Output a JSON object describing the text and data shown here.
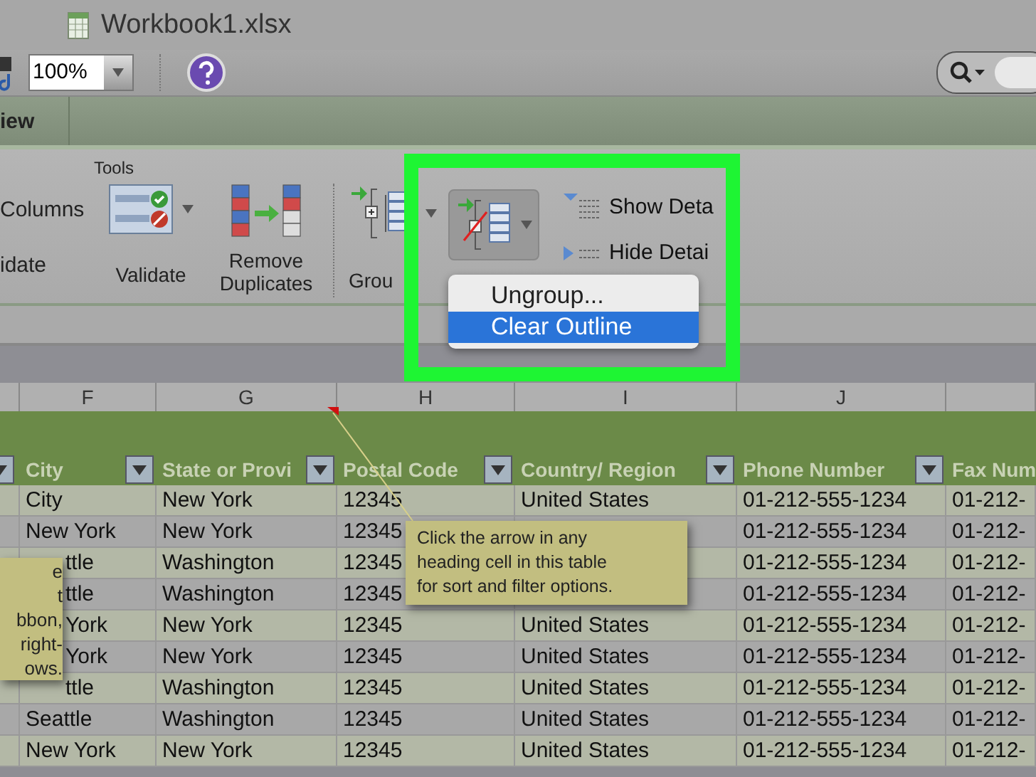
{
  "window": {
    "title": "Workbook1.xlsx"
  },
  "toolbar": {
    "zoom": "100%"
  },
  "tab_bar": {
    "tab": "iew"
  },
  "ribbon": {
    "group_label": "Tools",
    "items": [
      {
        "kind": "text_pair",
        "top": "Columns",
        "bottom": "idate"
      },
      {
        "kind": "validate",
        "label": "Validate"
      },
      {
        "kind": "remove_duplicates",
        "label": "Remove\nDuplicates"
      },
      {
        "kind": "group",
        "label": "Grou"
      },
      {
        "kind": "clear_outline"
      },
      {
        "kind": "detail",
        "top": "Show Deta",
        "bottom": "Hide Detai"
      }
    ]
  },
  "menu": {
    "items": [
      {
        "label": "Ungroup...",
        "selected": false
      },
      {
        "label": "Clear Outline",
        "selected": true
      }
    ]
  },
  "sheet": {
    "column_letters": [
      "F",
      "G",
      "H",
      "I",
      "J"
    ],
    "headers": [
      "City",
      "State or Provi",
      "Postal Code",
      "Country/ Region",
      "Phone Number",
      "Fax Num"
    ],
    "rows": [
      {
        "city_cut": false,
        "cells": [
          "City",
          "New York",
          "12345",
          "United States",
          "01-212-555-1234",
          "01-212-"
        ]
      },
      {
        "city_cut": false,
        "cells": [
          "New York",
          "New York",
          "12345",
          null,
          "01-212-555-1234",
          "01-212-"
        ]
      },
      {
        "city_cut": true,
        "cells": [
          "ttle",
          "Washington",
          "12345",
          null,
          "01-212-555-1234",
          "01-212-"
        ]
      },
      {
        "city_cut": true,
        "cells": [
          "ttle",
          "Washington",
          "12345",
          null,
          "01-212-555-1234",
          "01-212-"
        ]
      },
      {
        "city_cut": true,
        "cells": [
          "York",
          "New York",
          "12345",
          "United States",
          "01-212-555-1234",
          "01-212-"
        ]
      },
      {
        "city_cut": true,
        "cells": [
          "York",
          "New York",
          "12345",
          "United States",
          "01-212-555-1234",
          "01-212-"
        ]
      },
      {
        "city_cut": true,
        "cells": [
          "ttle",
          "Washington",
          "12345",
          "United States",
          "01-212-555-1234",
          "01-212-"
        ]
      },
      {
        "city_cut": false,
        "cells": [
          "Seattle",
          "Washington",
          "12345",
          "United States",
          "01-212-555-1234",
          "01-212-"
        ]
      },
      {
        "city_cut": false,
        "cells": [
          "New York",
          "New York",
          "12345",
          "United States",
          "01-212-555-1234",
          "01-212-"
        ]
      }
    ]
  },
  "comment": {
    "lines": [
      "Click the arrow in any",
      "heading cell in this table",
      "for sort and filter options."
    ]
  },
  "left_tip": {
    "lines": [
      "e",
      "t",
      "bbon,",
      "right-",
      "ows."
    ]
  }
}
